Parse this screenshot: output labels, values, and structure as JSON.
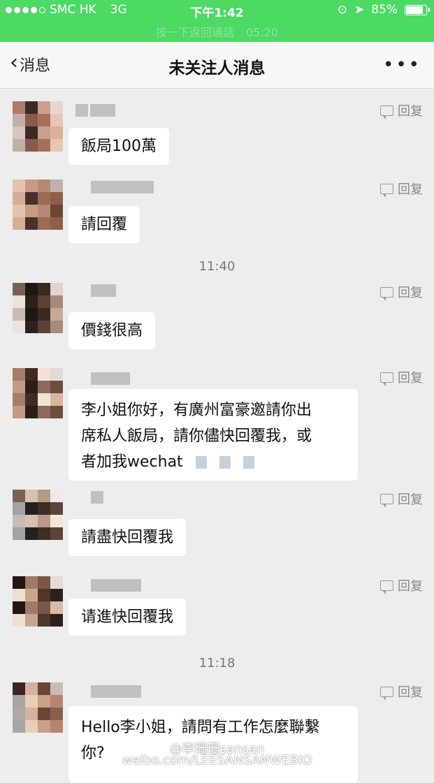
{
  "status_bar": {
    "carrier": "SMC HK",
    "network": "3G",
    "time": "下午1:42",
    "battery": "85%",
    "battery_level": 0.85,
    "call_banner": "按一下返回通話",
    "call_duration": "05:20"
  },
  "nav": {
    "back_label": "消息",
    "title": "未关注人消息",
    "more_icon": "more-dots-icon"
  },
  "reply_label": "回复",
  "messages": [
    {
      "type": "message",
      "text": "飯局100萬"
    },
    {
      "type": "message",
      "text": "請回覆"
    },
    {
      "type": "time",
      "text": "11:40"
    },
    {
      "type": "message",
      "text": "價錢很高"
    },
    {
      "type": "message",
      "lines": [
        "李小姐你好，有廣州富豪邀請你出",
        "席私人飯局，請你儘快回覆我，或",
        "者加我wechat"
      ]
    },
    {
      "type": "message",
      "text": "請盡快回覆我"
    },
    {
      "type": "message",
      "text": "请進快回覆我"
    },
    {
      "type": "time",
      "text": "11:18"
    },
    {
      "type": "message",
      "lines": [
        "Hello李小姐，請問有工作怎麼聯繫",
        "你?"
      ]
    }
  ],
  "watermark": {
    "handle": "@李珊珊sansan",
    "url": "weibo.com/LEESANSANWEBIO"
  }
}
